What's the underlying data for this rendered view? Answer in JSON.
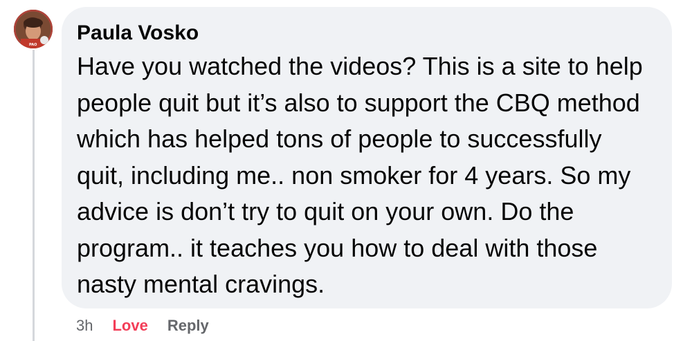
{
  "comment": {
    "author": "Paula Vosko",
    "text": "Have you watched the videos? This is a site to help people quit but it’s also to support the CBQ method which has helped tons of people to successfully quit, including me.. non smoker for 4 years. So my advice is don’t try to quit on your own. Do the program.. it teaches you how to deal with those nasty mental cravings.",
    "avatar_icon": "profile-photo",
    "avatar_badge": "PAO"
  },
  "actions": {
    "timestamp": "3h",
    "reaction_label": "Love",
    "reply_label": "Reply"
  },
  "colors": {
    "bubble_bg": "#f0f2f5",
    "text": "#050505",
    "meta": "#65676b",
    "love": "#f33e58"
  }
}
